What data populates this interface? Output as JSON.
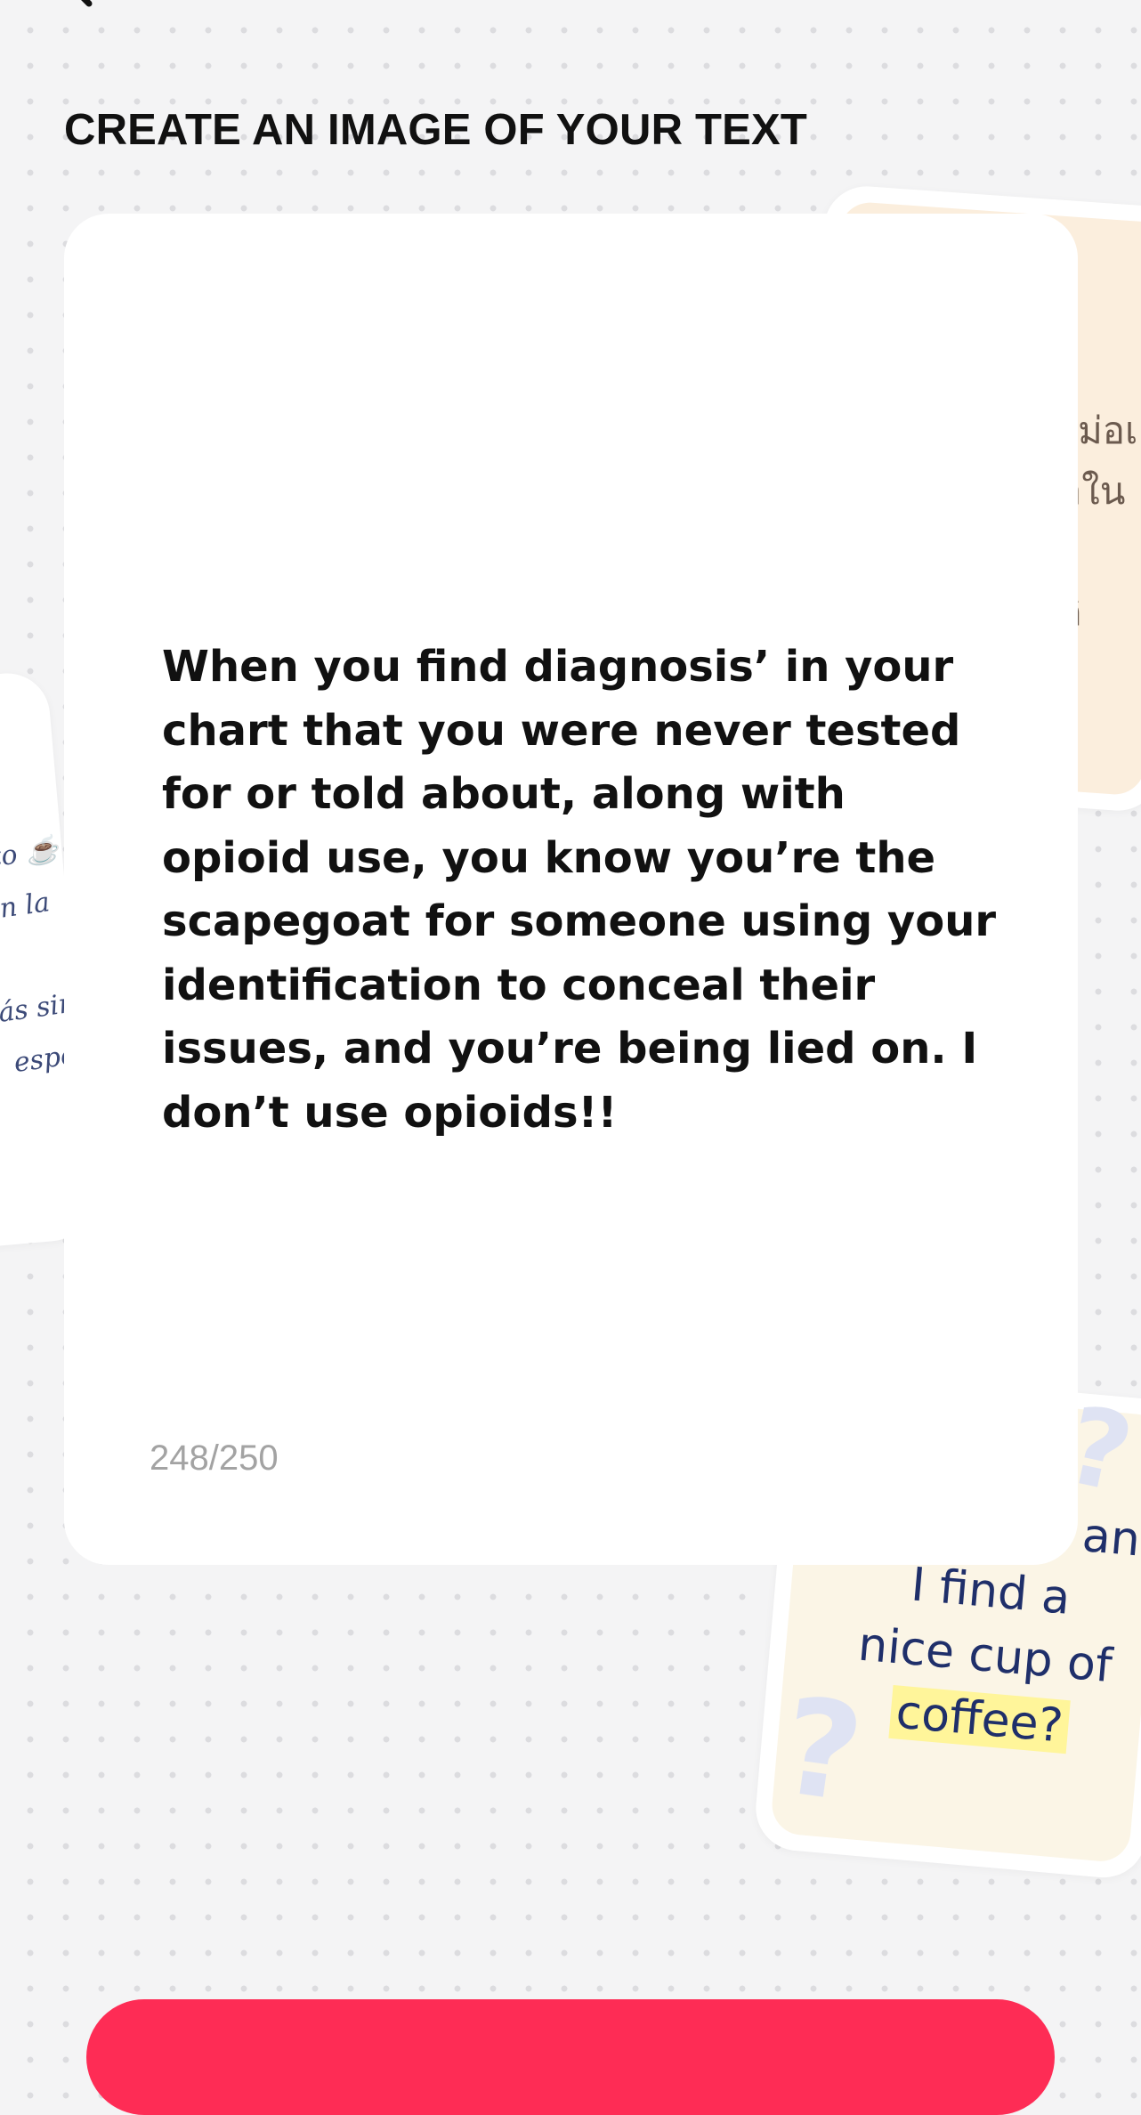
{
  "header": {
    "title": "CREATE AN IMAGE OF YOUR TEXT"
  },
  "editor": {
    "text": "When you find diagnosis’ in your chart that you were never tested for or told about, along with opioid use, you know you’re the scapegoat for someone using your identification to conceal their issues, and you’re being lied on. I don’t use opioids!!",
    "char_count": "248/250"
  },
  "decor": {
    "left_card_text": "sto ☕\nen la\n:\nás sin\n espec",
    "right_top_text": "ไม่อเ\nอใน\n  \nกิ",
    "right_bottom_text_line1": "an",
    "right_bottom_text_line2": "I find a",
    "right_bottom_text_line3": "nice cup of",
    "right_bottom_text_line4": "coffee?"
  },
  "colors": {
    "accent": "#fe2c55",
    "background": "#f4f4f5",
    "card": "#ffffff",
    "counter": "#a3a3a3"
  },
  "icons": {
    "back": "chevron-left-icon"
  }
}
